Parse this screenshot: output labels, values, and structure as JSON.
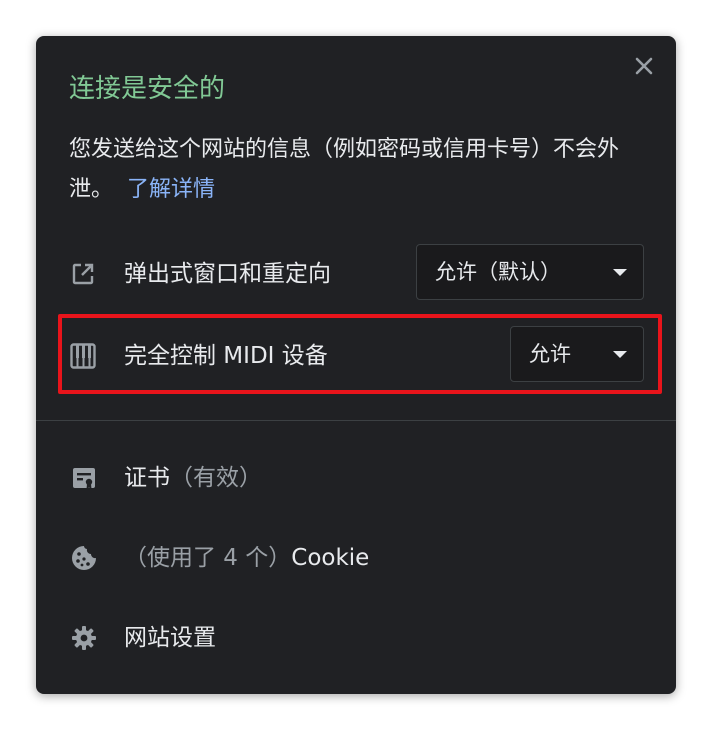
{
  "dialog": {
    "title": "连接是安全的",
    "description": "您发送给这个网站的信息（例如密码或信用卡号）不会外泄。",
    "learn_more": "了解详情"
  },
  "permissions": [
    {
      "label": "弹出式窗口和重定向",
      "value": "允许（默认）",
      "icon": "external-link-icon"
    },
    {
      "label": "完全控制 MIDI 设备",
      "value": "允许",
      "icon": "piano-icon"
    }
  ],
  "items": {
    "certificate": {
      "label": "证书",
      "status": "（有效）",
      "icon": "certificate-icon"
    },
    "cookies": {
      "prefix": "（使用了 4 个）",
      "label": "Cookie",
      "icon": "cookie-icon"
    },
    "site_settings": {
      "label": "网站设置",
      "icon": "gear-icon"
    }
  },
  "colors": {
    "secure_green": "#81c995",
    "link_blue": "#8ab4f8",
    "highlight_red": "#e8141b",
    "panel_bg": "#202124"
  }
}
